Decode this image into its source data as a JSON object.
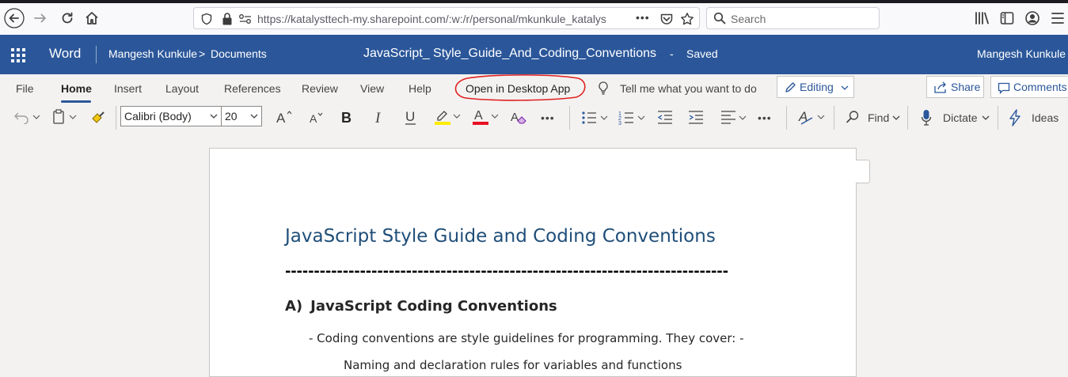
{
  "browser": {
    "url": "https://katalysttech-my.sharepoint.com/:w:/r/personal/mkunkule_katalys",
    "search_placeholder": "Search",
    "page_actions": "•••"
  },
  "word_header": {
    "app_name": "Word",
    "breadcrumb_owner": "Mangesh Kunkule",
    "breadcrumb_sep": ">",
    "breadcrumb_folder": "Documents",
    "doc_title": "JavaScript_ Style_Guide_And_Coding_Conventions",
    "status_sep": "-",
    "status": "Saved",
    "user": "Mangesh Kunkule"
  },
  "ribbon": {
    "tabs": [
      "File",
      "Home",
      "Insert",
      "Layout",
      "References",
      "Review",
      "View",
      "Help",
      "Open in Desktop App"
    ],
    "tell_me": "Tell me what you want to do",
    "editing": "Editing",
    "share": "Share",
    "comments": "Comments",
    "font_name": "Calibri (Body)",
    "font_size": "20",
    "find": "Find",
    "dictate": "Dictate",
    "ideas": "Ideas",
    "more": "•••",
    "annotation_color": "#e02020"
  },
  "document": {
    "title": "JavaScript Style Guide and Coding Conventions",
    "rule": "-----------------------------------------------------------------------------",
    "heading_num": "A)",
    "heading": "JavaScript Coding Conventions",
    "para1": "- Coding conventions are style guidelines for programming. They cover: -",
    "para2": "Naming and declaration rules for variables and functions"
  },
  "colors": {
    "word_blue": "#2b579a",
    "title_blue": "#1f4e79",
    "highlight_yellow": "#ffeb00",
    "font_red": "#e81123"
  }
}
